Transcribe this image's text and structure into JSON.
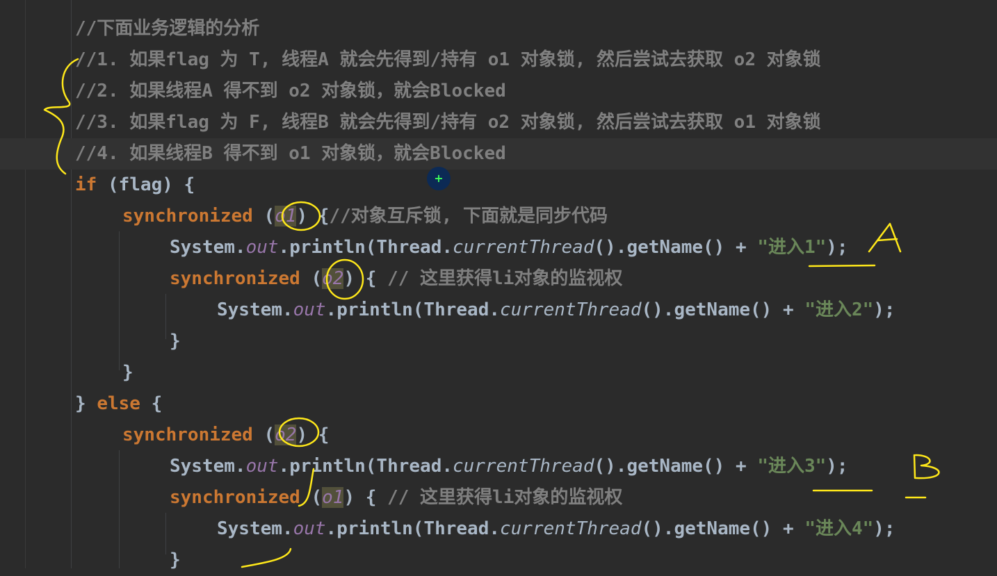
{
  "editor": {
    "lines": [
      {
        "indent": 0,
        "parts": [
          {
            "c": "cm",
            "t": "//下面业务逻辑的分析"
          }
        ]
      },
      {
        "indent": 0,
        "parts": [
          {
            "c": "cm",
            "t": "//1. 如果flag 为 T, 线程A 就会先得到/持有 o1 对象锁, 然后尝试去获取 o2 对象锁"
          }
        ]
      },
      {
        "indent": 0,
        "parts": [
          {
            "c": "cm",
            "t": "//2. 如果线程A 得不到 o2 对象锁，就会Blocked"
          }
        ]
      },
      {
        "indent": 0,
        "parts": [
          {
            "c": "cm",
            "t": "//3. 如果flag 为 F, 线程B 就会先得到/持有 o2 对象锁, 然后尝试去获取 o1 对象锁"
          }
        ]
      },
      {
        "indent": 0,
        "current": true,
        "parts": [
          {
            "c": "cm",
            "t": "//4. 如果线程B 得不到 o1 对象锁，就会Blocked"
          }
        ]
      },
      {
        "indent": 0,
        "parts": [
          {
            "c": "kw",
            "t": "if"
          },
          {
            "c": "",
            "t": " (flag) {"
          }
        ]
      },
      {
        "indent": 1,
        "parts": [
          {
            "c": "kw",
            "t": "synchronized"
          },
          {
            "c": "",
            "t": " ("
          },
          {
            "c": "fld hl",
            "t": "o1"
          },
          {
            "c": "",
            "t": ") {"
          },
          {
            "c": "cm",
            "t": "//对象互斥锁, 下面就是同步代码"
          }
        ]
      },
      {
        "indent": 2,
        "parts": [
          {
            "c": "",
            "t": "System."
          },
          {
            "c": "fld",
            "t": "out"
          },
          {
            "c": "",
            "t": ".println(Thread."
          },
          {
            "c": "it",
            "t": "currentThread"
          },
          {
            "c": "",
            "t": "().getName() + "
          },
          {
            "c": "str",
            "t": "\"进入1\""
          },
          {
            "c": "",
            "t": ");"
          }
        ]
      },
      {
        "indent": 2,
        "parts": [
          {
            "c": "kw",
            "t": "synchronized"
          },
          {
            "c": "",
            "t": " ("
          },
          {
            "c": "fld hl",
            "t": "o2"
          },
          {
            "c": "",
            "t": ") { "
          },
          {
            "c": "cm",
            "t": "// 这里获得li对象的监视权"
          }
        ]
      },
      {
        "indent": 3,
        "parts": [
          {
            "c": "",
            "t": "System."
          },
          {
            "c": "fld",
            "t": "out"
          },
          {
            "c": "",
            "t": ".println(Thread."
          },
          {
            "c": "it",
            "t": "currentThread"
          },
          {
            "c": "",
            "t": "().getName() + "
          },
          {
            "c": "str",
            "t": "\"进入2\""
          },
          {
            "c": "",
            "t": ");"
          }
        ]
      },
      {
        "indent": 2,
        "parts": [
          {
            "c": "",
            "t": "}"
          }
        ]
      },
      {
        "indent": 1,
        "parts": [
          {
            "c": "",
            "t": "}"
          }
        ]
      },
      {
        "indent": 0,
        "parts": [
          {
            "c": "",
            "t": "} "
          },
          {
            "c": "kw",
            "t": "else"
          },
          {
            "c": "",
            "t": " {"
          }
        ]
      },
      {
        "indent": 1,
        "parts": [
          {
            "c": "kw",
            "t": "synchronized"
          },
          {
            "c": "",
            "t": " ("
          },
          {
            "c": "fld hl",
            "t": "o2"
          },
          {
            "c": "",
            "t": ") {"
          }
        ]
      },
      {
        "indent": 2,
        "parts": [
          {
            "c": "",
            "t": "System."
          },
          {
            "c": "fld",
            "t": "out"
          },
          {
            "c": "",
            "t": ".println(Thread."
          },
          {
            "c": "it",
            "t": "currentThread"
          },
          {
            "c": "",
            "t": "().getName() + "
          },
          {
            "c": "str",
            "t": "\"进入3\""
          },
          {
            "c": "",
            "t": ");"
          }
        ]
      },
      {
        "indent": 2,
        "parts": [
          {
            "c": "kw",
            "t": "synchronized"
          },
          {
            "c": "",
            "t": " ("
          },
          {
            "c": "fld hl",
            "t": "o1"
          },
          {
            "c": "",
            "t": ") { "
          },
          {
            "c": "cm",
            "t": "// 这里获得li对象的监视权"
          }
        ]
      },
      {
        "indent": 3,
        "parts": [
          {
            "c": "",
            "t": "System."
          },
          {
            "c": "fld",
            "t": "out"
          },
          {
            "c": "",
            "t": ".println(Thread."
          },
          {
            "c": "it",
            "t": "currentThread"
          },
          {
            "c": "",
            "t": "().getName() + "
          },
          {
            "c": "str",
            "t": "\"进入4\""
          },
          {
            "c": "",
            "t": ");"
          }
        ]
      },
      {
        "indent": 2,
        "parts": [
          {
            "c": "",
            "t": "}"
          }
        ]
      }
    ]
  },
  "cursor": {
    "glyph": "+"
  },
  "annotations": {
    "labels": [
      "A",
      "B"
    ]
  },
  "colors": {
    "background": "#2b2b2b",
    "comment": "#808080",
    "keyword": "#cc7832",
    "field": "#9876aa",
    "string": "#6a8759",
    "text": "#a9b7c6",
    "annotation": "#ffe81a"
  }
}
